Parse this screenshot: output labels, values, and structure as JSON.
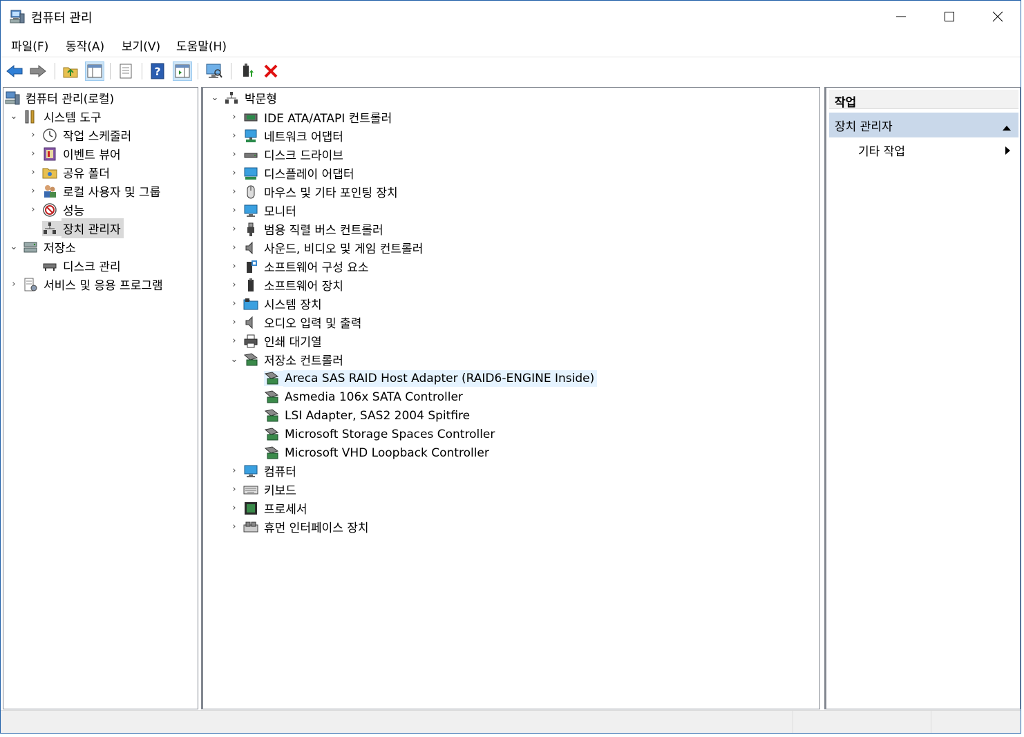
{
  "window": {
    "title": "컴퓨터 관리"
  },
  "menu": [
    "파일(F)",
    "동작(A)",
    "보기(V)",
    "도움말(H)"
  ],
  "left_tree": [
    {
      "label": "컴퓨터 관리(로컬)",
      "level": 0,
      "twisty": "",
      "icon": "computer-management-icon"
    },
    {
      "label": "시스템 도구",
      "level": 1,
      "twisty": "v",
      "icon": "tools-icon"
    },
    {
      "label": "작업 스케줄러",
      "level": 2,
      "twisty": ">",
      "icon": "clock-icon"
    },
    {
      "label": "이벤트 뷰어",
      "level": 2,
      "twisty": ">",
      "icon": "event-viewer-icon"
    },
    {
      "label": "공유 폴더",
      "level": 2,
      "twisty": ">",
      "icon": "shared-folder-icon"
    },
    {
      "label": "로컬 사용자 및 그룹",
      "level": 2,
      "twisty": ">",
      "icon": "users-icon"
    },
    {
      "label": "성능",
      "level": 2,
      "twisty": ">",
      "icon": "performance-icon"
    },
    {
      "label": "장치 관리자",
      "level": 2,
      "twisty": "",
      "icon": "device-manager-icon",
      "selected": true
    },
    {
      "label": "저장소",
      "level": 1,
      "twisty": "v",
      "icon": "storage-icon"
    },
    {
      "label": "디스크 관리",
      "level": 2,
      "twisty": "",
      "icon": "disk-management-icon"
    },
    {
      "label": "서비스 및 응용 프로그램",
      "level": 1,
      "twisty": ">",
      "icon": "services-icon"
    }
  ],
  "device_tree": [
    {
      "label": "박문형",
      "level": 0,
      "twisty": "v",
      "icon": "computer-root-icon"
    },
    {
      "label": "IDE ATA/ATAPI 컨트롤러",
      "level": 1,
      "twisty": ">",
      "icon": "ide-controller-icon"
    },
    {
      "label": "네트워크 어댑터",
      "level": 1,
      "twisty": ">",
      "icon": "network-adapter-icon"
    },
    {
      "label": "디스크 드라이브",
      "level": 1,
      "twisty": ">",
      "icon": "disk-drive-icon"
    },
    {
      "label": "디스플레이 어댑터",
      "level": 1,
      "twisty": ">",
      "icon": "display-adapter-icon"
    },
    {
      "label": "마우스 및 기타 포인팅 장치",
      "level": 1,
      "twisty": ">",
      "icon": "mouse-icon"
    },
    {
      "label": "모니터",
      "level": 1,
      "twisty": ">",
      "icon": "monitor-icon"
    },
    {
      "label": "범용 직렬 버스 컨트롤러",
      "level": 1,
      "twisty": ">",
      "icon": "usb-icon"
    },
    {
      "label": "사운드, 비디오 및 게임 컨트롤러",
      "level": 1,
      "twisty": ">",
      "icon": "speaker-icon"
    },
    {
      "label": "소프트웨어 구성 요소",
      "level": 1,
      "twisty": ">",
      "icon": "software-component-icon"
    },
    {
      "label": "소프트웨어 장치",
      "level": 1,
      "twisty": ">",
      "icon": "software-device-icon"
    },
    {
      "label": "시스템 장치",
      "level": 1,
      "twisty": ">",
      "icon": "system-device-icon"
    },
    {
      "label": "오디오 입력 및 출력",
      "level": 1,
      "twisty": ">",
      "icon": "audio-icon"
    },
    {
      "label": "인쇄 대기열",
      "level": 1,
      "twisty": ">",
      "icon": "printer-icon"
    },
    {
      "label": "저장소 컨트롤러",
      "level": 1,
      "twisty": "v",
      "icon": "storage-controller-icon"
    },
    {
      "label": "Areca SAS RAID Host Adapter (RAID6-ENGINE Inside)",
      "level": 2,
      "twisty": "",
      "icon": "storage-controller-icon",
      "selected": true
    },
    {
      "label": "Asmedia 106x SATA Controller",
      "level": 2,
      "twisty": "",
      "icon": "storage-controller-icon"
    },
    {
      "label": "LSI Adapter, SAS2 2004 Spitfire",
      "level": 2,
      "twisty": "",
      "icon": "storage-controller-icon"
    },
    {
      "label": "Microsoft Storage Spaces Controller",
      "level": 2,
      "twisty": "",
      "icon": "storage-controller-icon"
    },
    {
      "label": "Microsoft VHD Loopback Controller",
      "level": 2,
      "twisty": "",
      "icon": "storage-controller-icon"
    },
    {
      "label": "컴퓨터",
      "level": 1,
      "twisty": ">",
      "icon": "computer-icon"
    },
    {
      "label": "키보드",
      "level": 1,
      "twisty": ">",
      "icon": "keyboard-icon"
    },
    {
      "label": "프로세서",
      "level": 1,
      "twisty": ">",
      "icon": "processor-icon"
    },
    {
      "label": "휴먼 인터페이스 장치",
      "level": 1,
      "twisty": ">",
      "icon": "hid-icon"
    }
  ],
  "actions": {
    "header": "작업",
    "section": "장치 관리자",
    "item": "기타 작업"
  }
}
